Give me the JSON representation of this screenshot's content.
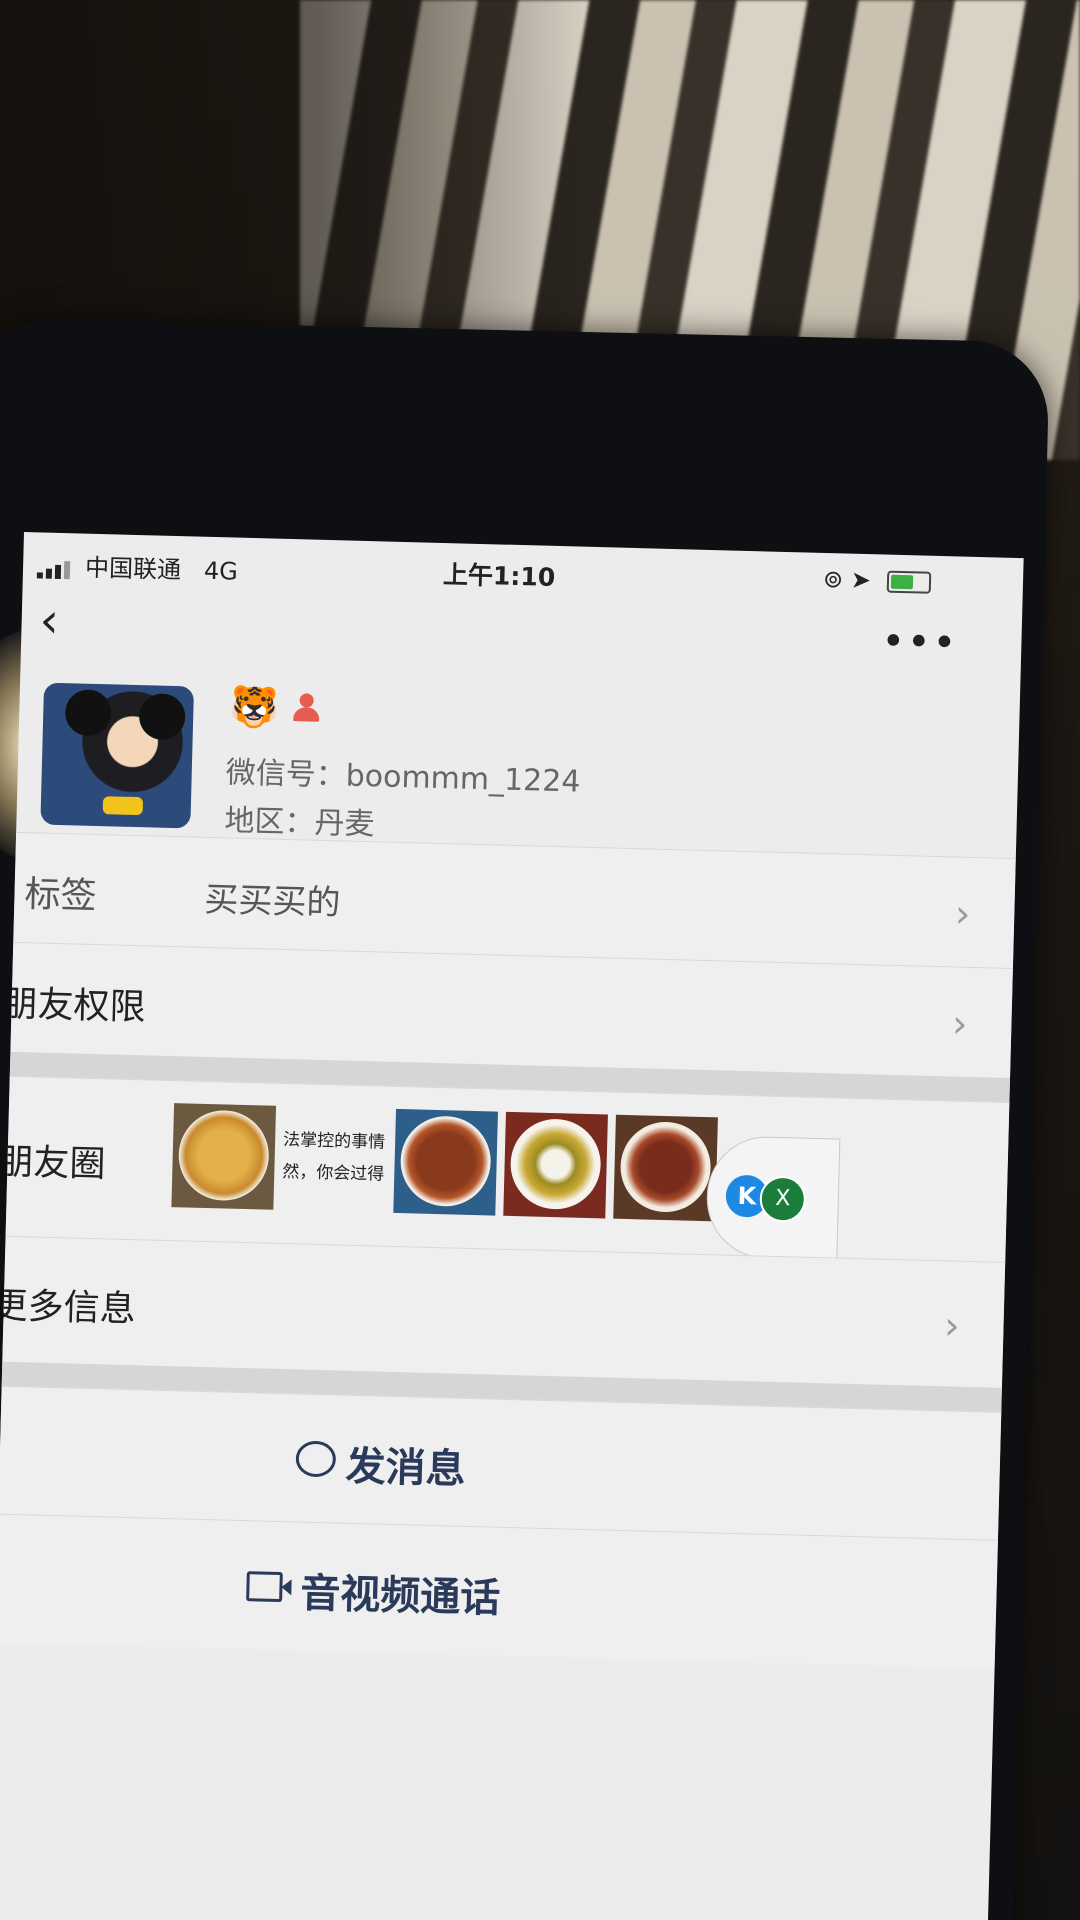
{
  "status_bar": {
    "carrier": "中国联通",
    "network": "4G",
    "time": "上午1:10"
  },
  "nav": {
    "back_icon": "chevron-left-icon",
    "more_icon": "ellipsis-icon"
  },
  "profile": {
    "zodiac_emoji": "🐯",
    "wechat_id": "微信号：boommm_1224",
    "region": "地区：丹麦"
  },
  "rows": {
    "tags_label": "标签",
    "tags_value": "买买买的",
    "permissions_label": "朋友权限",
    "moments_label": "朋友圈",
    "moments_text_line1": "法掌控的事情",
    "moments_text_line2": "然，你会过得",
    "more_info_label": "更多信息"
  },
  "actions": {
    "send_message": "发消息",
    "video_call": "音视频通话"
  },
  "floating_widget": {
    "left_badge": "K",
    "right_badge": "X"
  },
  "colors": {
    "action_text": "#2a3a5a",
    "screen_bg": "#ececec"
  }
}
